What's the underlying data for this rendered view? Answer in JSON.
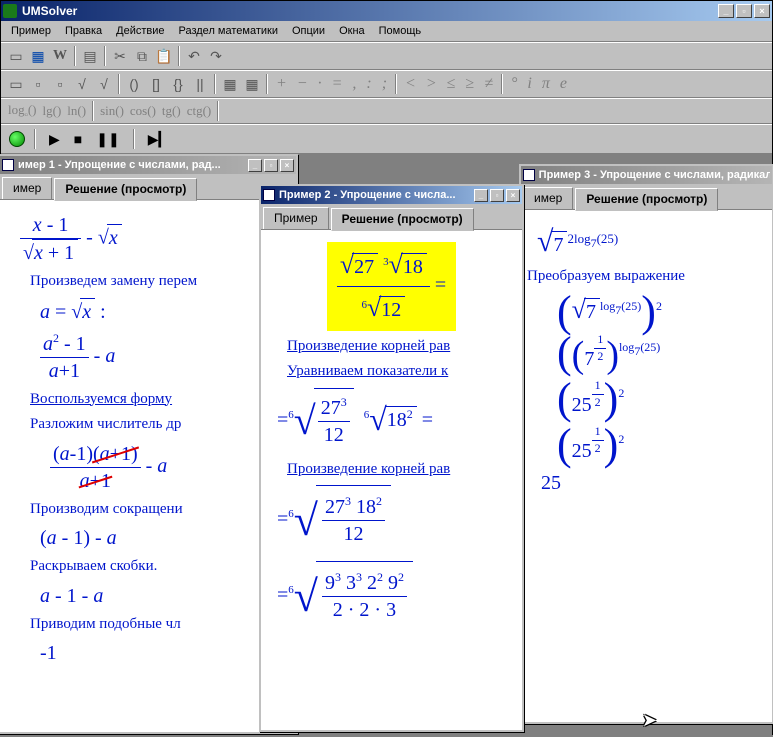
{
  "app": {
    "title": "UMSolver"
  },
  "menu": {
    "items": [
      "Пример",
      "Правка",
      "Действие",
      "Раздел математики",
      "Опции",
      "Окна",
      "Помощь"
    ]
  },
  "toolbar": {
    "funcs": [
      "log_b()",
      "lg()",
      "ln()",
      "sin()",
      "cos()",
      "tg()",
      "ctg()"
    ],
    "ops": [
      "+",
      "−",
      "·",
      "=",
      ",",
      ":",
      ";"
    ],
    "cmp": [
      "<",
      ">",
      "≤",
      "≥",
      "≠"
    ],
    "greek": [
      "°",
      "i",
      "π",
      "e"
    ]
  },
  "win1": {
    "title": "имер 1 - Упрощение с числами, рад...",
    "tabs": [
      "имер",
      "Решение (просмотр)"
    ],
    "t1": "Произведем замену перем",
    "t2": "Воспользуемся форму",
    "t3": "Разложим числитель др",
    "t4": "Производим сокращени",
    "t5": "Раскрываем скобки.",
    "t6": "Приводим подобные чл",
    "e_minus1": "-1"
  },
  "win2": {
    "title": "Пример 2 - Упрощение с числа...",
    "tabs": [
      "Пример",
      "Решение (просмотр)"
    ],
    "t1": "Произведение корней рав",
    "t2": "Уравниваем показатели к",
    "t3": "Произведение корней рав"
  },
  "win3": {
    "title": "Пример 3 - Упрощение с числами, радикала",
    "tabs": [
      "имер",
      "Решение (просмотр)"
    ],
    "t1": "Преобразуем выражение",
    "n25": "25"
  },
  "chart_data": {
    "type": "table",
    "title": "Math expressions displayed",
    "example1": {
      "orig_expr": "(x-1)/sqrt(x+1) - sqrt(x)",
      "substitution": "a = sqrt(x)",
      "step2": "(a^2 - 1)/(a+1) - a",
      "step3": "((a-1)(a+1))/(a+1) - a",
      "step4": "(a-1) - a",
      "step5": "a - 1 - a",
      "result": "-1"
    },
    "example2": {
      "orig_expr": "(sqrt(27) * cbrt(18)) / sixthroot(12) =",
      "step2": "= sixthroot(27^3 / 12) * sixthroot(18^2) =",
      "step3": "= sixthroot( 27^3 * 18^2 / 12 )",
      "step4": "= sixthroot( 9^3 * 3^3 * 2^2 * 9^2 / (2*2*3) )"
    },
    "example3": {
      "orig_expr": "sqrt(7) ^ (2*log_7(25))",
      "step1": "( sqrt(7)^(log_7(25)) )^2",
      "step2": "( (7^(1/2)) )^(log_7(25))",
      "step3": "( 25^(1/2) )^2",
      "step4": "( 25^(1/2) )^2",
      "result": "25"
    }
  }
}
